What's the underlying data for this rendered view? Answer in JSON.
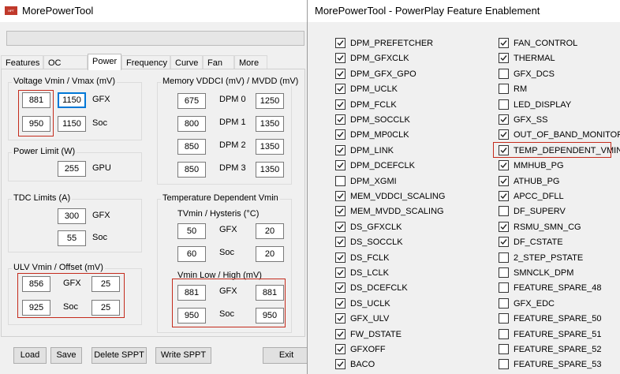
{
  "left_window": {
    "title": "MorePowerTool",
    "app_icon_text": "MPT",
    "tabs": [
      "Features",
      "OC Limits",
      "Power",
      "Frequency",
      "Curve",
      "Fan",
      "More"
    ],
    "active_tab": "Power",
    "voltage": {
      "title": "Voltage Vmin / Vmax (mV)",
      "gfx_label": "GFX",
      "soc_label": "Soc",
      "gfx_vmin": "881",
      "gfx_vmax": "1150",
      "soc_vmin": "950",
      "soc_vmax": "1150"
    },
    "power_limit": {
      "title": "Power Limit (W)",
      "value": "255",
      "label": "GPU"
    },
    "tdc": {
      "title": "TDC Limits (A)",
      "gfx": "300",
      "gfx_label": "GFX",
      "soc": "55",
      "soc_label": "Soc"
    },
    "ulv": {
      "title": "ULV Vmin / Offset (mV)",
      "gfx_vmin": "856",
      "gfx_offset": "25",
      "gfx_label": "GFX",
      "soc_vmin": "925",
      "soc_offset": "25",
      "soc_label": "Soc"
    },
    "memory": {
      "title": "Memory VDDCI (mV) / MVDD (mV)",
      "rows": [
        {
          "vddci": "675",
          "label": "DPM 0",
          "mvdd": "1250"
        },
        {
          "vddci": "800",
          "label": "DPM 1",
          "mvdd": "1350"
        },
        {
          "vddci": "850",
          "label": "DPM 2",
          "mvdd": "1350"
        },
        {
          "vddci": "850",
          "label": "DPM 3",
          "mvdd": "1350"
        }
      ]
    },
    "temp_vmin": {
      "title": "Temperature Dependent Vmin",
      "tvmin_title": "TVmin / Hysteris (°C)",
      "gfx_label": "GFX",
      "soc_label": "Soc",
      "tvmin_gfx": "50",
      "hyst_gfx": "20",
      "tvmin_soc": "60",
      "hyst_soc": "20",
      "vmin_title": "Vmin Low / High (mV)",
      "low_gfx": "881",
      "high_gfx": "881",
      "low_soc": "950",
      "high_soc": "950"
    },
    "buttons": {
      "load": "Load",
      "save": "Save",
      "delete": "Delete SPPT",
      "write": "Write SPPT",
      "exit": "Exit"
    }
  },
  "right_window": {
    "title": "MorePowerTool - PowerPlay Feature Enablement",
    "left_column": [
      {
        "label": "DPM_PREFETCHER",
        "checked": true
      },
      {
        "label": "DPM_GFXCLK",
        "checked": true
      },
      {
        "label": "DPM_GFX_GPO",
        "checked": true
      },
      {
        "label": "DPM_UCLK",
        "checked": true
      },
      {
        "label": "DPM_FCLK",
        "checked": true
      },
      {
        "label": "DPM_SOCCLK",
        "checked": true
      },
      {
        "label": "DPM_MP0CLK",
        "checked": true
      },
      {
        "label": "DPM_LINK",
        "checked": true
      },
      {
        "label": "DPM_DCEFCLK",
        "checked": true
      },
      {
        "label": "DPM_XGMI",
        "checked": false
      },
      {
        "label": "MEM_VDDCI_SCALING",
        "checked": true
      },
      {
        "label": "MEM_MVDD_SCALING",
        "checked": true
      },
      {
        "label": "DS_GFXCLK",
        "checked": true
      },
      {
        "label": "DS_SOCCLK",
        "checked": true
      },
      {
        "label": "DS_FCLK",
        "checked": true
      },
      {
        "label": "DS_LCLK",
        "checked": true
      },
      {
        "label": "DS_DCEFCLK",
        "checked": true
      },
      {
        "label": "DS_UCLK",
        "checked": true
      },
      {
        "label": "GFX_ULV",
        "checked": true
      },
      {
        "label": "FW_DSTATE",
        "checked": true
      },
      {
        "label": "GFXOFF",
        "checked": true
      },
      {
        "label": "BACO",
        "checked": true
      }
    ],
    "right_column": [
      {
        "label": "FAN_CONTROL",
        "checked": true
      },
      {
        "label": "THERMAL",
        "checked": true
      },
      {
        "label": "GFX_DCS",
        "checked": false
      },
      {
        "label": "RM",
        "checked": false
      },
      {
        "label": "LED_DISPLAY",
        "checked": false
      },
      {
        "label": "GFX_SS",
        "checked": true
      },
      {
        "label": "OUT_OF_BAND_MONITOR",
        "checked": true
      },
      {
        "label": "TEMP_DEPENDENT_VMIN",
        "checked": true
      },
      {
        "label": "MMHUB_PG",
        "checked": true
      },
      {
        "label": "ATHUB_PG",
        "checked": true
      },
      {
        "label": "APCC_DFLL",
        "checked": true
      },
      {
        "label": "DF_SUPERV",
        "checked": false
      },
      {
        "label": "RSMU_SMN_CG",
        "checked": true
      },
      {
        "label": "DF_CSTATE",
        "checked": true
      },
      {
        "label": "2_STEP_PSTATE",
        "checked": false
      },
      {
        "label": "SMNCLK_DPM",
        "checked": false
      },
      {
        "label": "FEATURE_SPARE_48",
        "checked": false
      },
      {
        "label": "GFX_EDC",
        "checked": false
      },
      {
        "label": "FEATURE_SPARE_50",
        "checked": false
      },
      {
        "label": "FEATURE_SPARE_51",
        "checked": false
      },
      {
        "label": "FEATURE_SPARE_52",
        "checked": false
      },
      {
        "label": "FEATURE_SPARE_53",
        "checked": false
      }
    ]
  }
}
